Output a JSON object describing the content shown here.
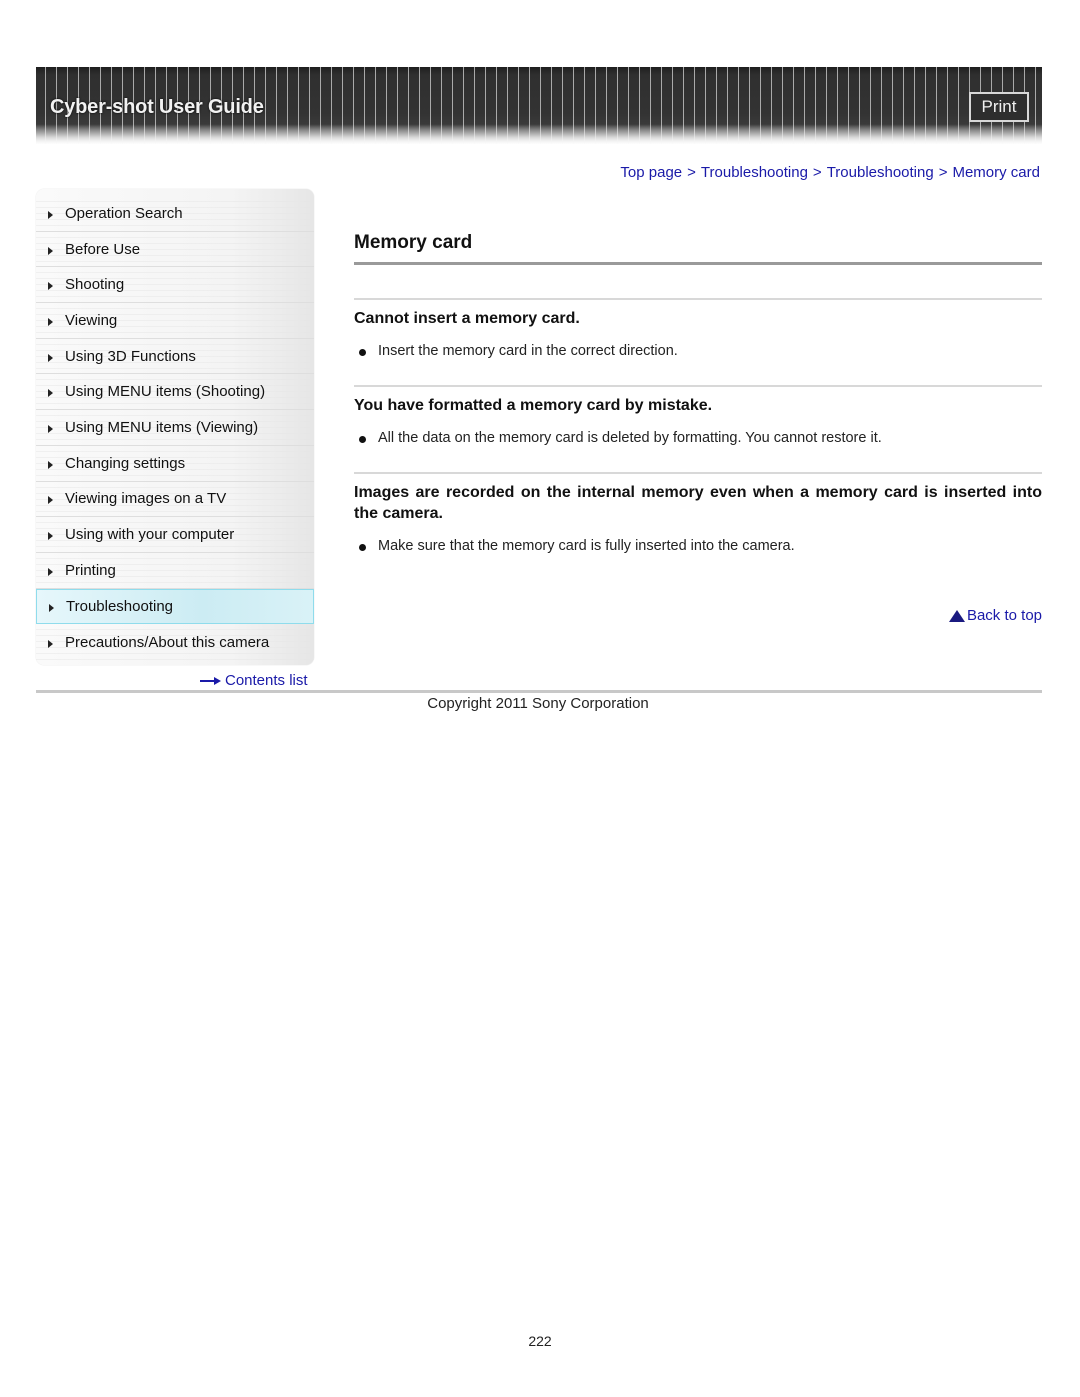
{
  "header": {
    "title": "Cyber-shot User Guide",
    "print_label": "Print"
  },
  "breadcrumb": {
    "items": [
      "Top page",
      "Troubleshooting",
      "Troubleshooting",
      "Memory card"
    ],
    "separator": ">"
  },
  "sidebar": {
    "items": [
      {
        "label": "Operation Search"
      },
      {
        "label": "Before Use"
      },
      {
        "label": "Shooting"
      },
      {
        "label": "Viewing"
      },
      {
        "label": "Using 3D Functions"
      },
      {
        "label": "Using MENU items (Shooting)"
      },
      {
        "label": "Using MENU items (Viewing)"
      },
      {
        "label": "Changing settings"
      },
      {
        "label": "Viewing images on a TV"
      },
      {
        "label": "Using with your computer"
      },
      {
        "label": "Printing"
      },
      {
        "label": "Troubleshooting",
        "active": true
      },
      {
        "label": "Precautions/About this camera"
      }
    ],
    "contents_link": "Contents list"
  },
  "main": {
    "title": "Memory card",
    "sections": [
      {
        "heading": "Cannot insert a memory card.",
        "bullets": [
          "Insert the memory card in the correct direction."
        ]
      },
      {
        "heading": "You have formatted a memory card by mistake.",
        "bullets": [
          "All the data on the memory card is deleted by formatting. You cannot restore it."
        ]
      },
      {
        "heading": "Images are recorded on the internal memory even when a memory card is inserted into the camera.",
        "bullets": [
          "Make sure that the memory card is fully inserted into the camera."
        ]
      }
    ],
    "back_to_top": "Back to top"
  },
  "footer": {
    "copyright": "Copyright 2011 Sony Corporation",
    "page_number": "222"
  },
  "colors": {
    "link": "#1a1aa8",
    "active_nav": "#ccecf3",
    "banner": "#333333"
  }
}
